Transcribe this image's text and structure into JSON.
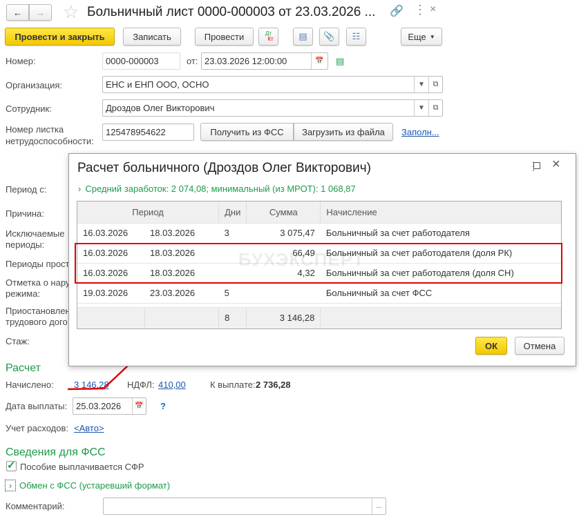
{
  "window": {
    "title": "Больничный лист 0000-000003 от 23.03.2026 ..."
  },
  "toolbar": {
    "post_close": "Провести и закрыть",
    "save": "Записать",
    "post": "Провести",
    "dtkt_dt": "Дт",
    "dtkt_kt": "Кт",
    "more": "Еще"
  },
  "form": {
    "number_label": "Номер:",
    "number": "0000-000003",
    "from_label": "от:",
    "date": "23.03.2026 12:00:00",
    "org_label": "Организация:",
    "org": "ЕНС и ЕНП ООО, ОСНО",
    "employee_label": "Сотрудник:",
    "employee": "Дроздов Олег Викторович",
    "sheet_label_1": "Номер листка",
    "sheet_label_2": "нетрудоспособности:",
    "sheet_number": "125478954622",
    "get_fss": "Получить из ФСС",
    "load_file": "Загрузить из файла",
    "fill": "Заполн...",
    "left_labels": [
      "Период с:",
      "Причина:",
      "Исключаемые",
      "периоды:",
      "Периоды прост",
      "Отметка о нару",
      "режима:",
      "Приостановлен",
      "трудового дого",
      "Стаж:"
    ]
  },
  "calc": {
    "title": "Расчет",
    "accrued_label": "Начислено:",
    "accrued": "3 146,28",
    "ndfl_label": "НДФЛ:",
    "ndfl": "410,00",
    "pay_label": "К выплате:",
    "pay": "2 736,28",
    "pay_date_label": "Дата выплаты:",
    "pay_date": "25.03.2026",
    "help": "?",
    "expense_label": "Учет расходов:",
    "expense": "<Авто>"
  },
  "fss": {
    "title": "Сведения для ФСС",
    "benefit_sfr": "Пособие выплачивается СФР",
    "benefit_checked": true,
    "exchange": "Обмен с ФСС (устаревший формат)",
    "comment_label": "Комментарий:",
    "comment": "",
    "dots": "..."
  },
  "dialog": {
    "title": "Расчет больничного (Дроздов Олег Викторович)",
    "summary": "Средний заработок: 2 074,08; минимальный (из МРОТ): 1 068,87",
    "columns": [
      "Период",
      "Дни",
      "Сумма",
      "Начисление"
    ],
    "rows": [
      {
        "from": "16.03.2026",
        "to": "18.03.2026",
        "days": "3",
        "sum": "3 075,47",
        "accrual": "Больничный за счет работодателя"
      },
      {
        "from": "16.03.2026",
        "to": "18.03.2026",
        "days": "",
        "sum": "66,49",
        "accrual": "Больничный за счет работодателя (доля РК)"
      },
      {
        "from": "16.03.2026",
        "to": "18.03.2026",
        "days": "",
        "sum": "4,32",
        "accrual": "Больничный за счет работодателя (доля СН)"
      },
      {
        "from": "19.03.2026",
        "to": "23.03.2026",
        "days": "5",
        "sum": "",
        "accrual": "Больничный за счет ФСС"
      }
    ],
    "total_days": "8",
    "total_sum": "3 146,28",
    "ok": "ОК",
    "cancel": "Отмена",
    "watermark": "БУХЭКСПЕРТ"
  },
  "colors": {
    "accent_yellow": "#f5d000",
    "green": "#1d9a4a",
    "highlight_red": "#e00000",
    "link": "#1a56b0"
  }
}
